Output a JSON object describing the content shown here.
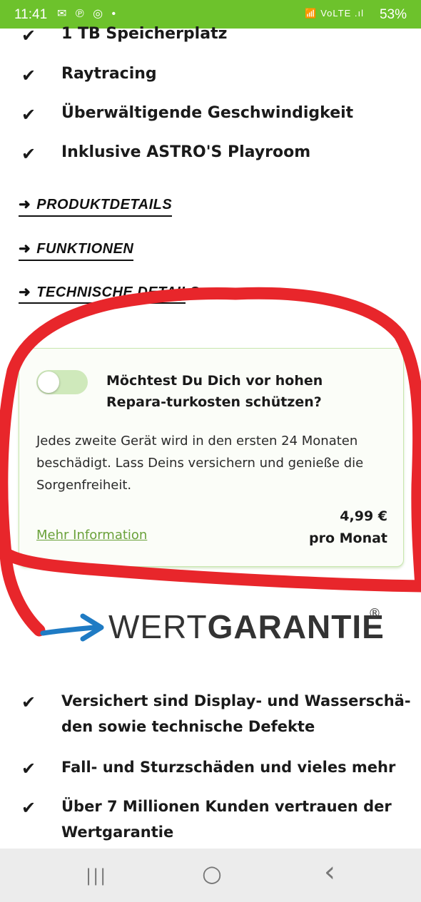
{
  "status_bar": {
    "time": "11:41",
    "notification_icons": "✉ ℗ ◎ •",
    "network_icons": "📶 VoLTE .ıl",
    "battery": "53%"
  },
  "features_top": [
    {
      "text": "1 TB Speicherplatz"
    },
    {
      "text": "Raytracing"
    },
    {
      "text": "Überwältigende Geschwindigkeit"
    },
    {
      "text": "Inklusive ASTRO'S Playroom"
    }
  ],
  "check_glyph": "✔",
  "arrow_glyph": "➜",
  "section_links": [
    {
      "label": "PRODUKTDETAILS"
    },
    {
      "label": "FUNKTIONEN"
    },
    {
      "label": "TECHNISCHE DETAILS"
    }
  ],
  "insurance_card": {
    "question": "Möchtest Du Dich vor hohen Repara-turkosten schützen?",
    "description": "Jedes zweite Gerät wird in den ersten 24 Monaten beschädigt. Lass Deins versichern und genieße die Sorgenfreiheit.",
    "price": "4,99 €",
    "price_period": "pro Monat",
    "more_link": "Mehr Information",
    "toggle_on": false
  },
  "logo": {
    "light_part": "WERT",
    "bold_part": "GARANTIE",
    "registered": "®"
  },
  "features_bottom": [
    {
      "line1": "Versichert sind Display- und Wasserschä-",
      "line2": "den sowie technische Defekte"
    },
    {
      "line1": "Fall- und Sturzschäden und vieles mehr",
      "line2": ""
    },
    {
      "line1": "Über 7 Millionen Kunden vertrauen der",
      "line2": "Wertgarantie"
    }
  ],
  "nav": {
    "recents": "|||",
    "home": "○",
    "back": "‹"
  },
  "colors": {
    "status_bar": "#6dc22c",
    "accent_green": "#6aa13a",
    "annotation_red": "#e8262b",
    "logo_arrow_blue": "#1f7bc4"
  }
}
